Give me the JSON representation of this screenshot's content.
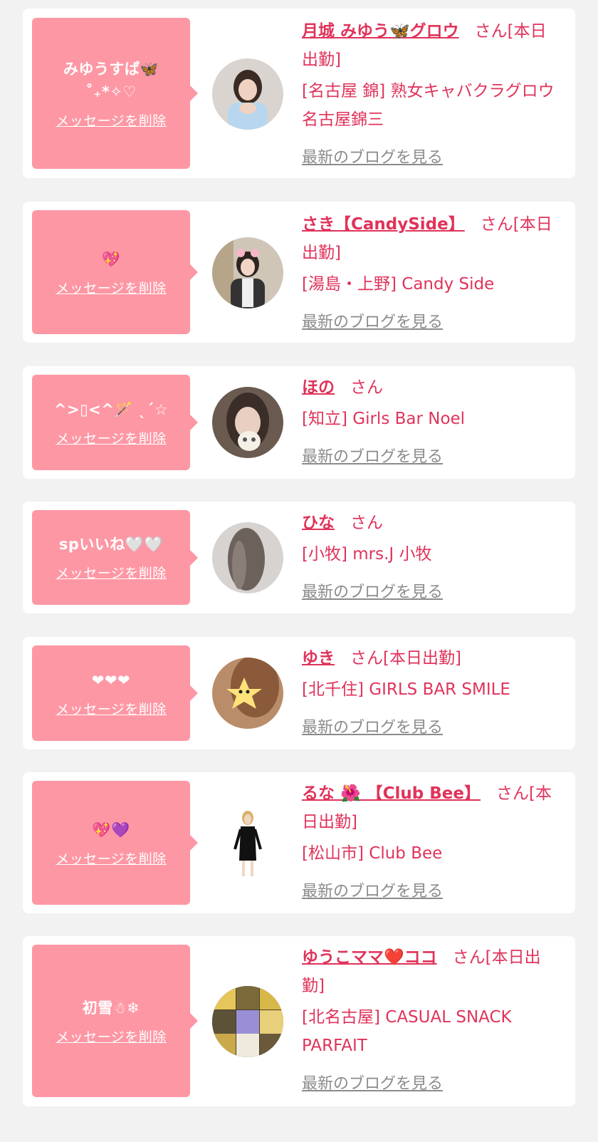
{
  "delete_label": "メッセージを削除",
  "blog_label": "最新のブログを見る",
  "colors": {
    "background": "#f2f2f2",
    "card": "#ffffff",
    "bubble": "#fe97a4",
    "accent": "#e0335a",
    "link_gray": "#8b8b8b"
  },
  "cards": [
    {
      "message": "みゆうすぱ🦋\n˚₊*✧♡",
      "name": "月城 みゆう🦋グロウ",
      "suffix": "さん[本日出勤]",
      "shop": "[名古屋 錦] 熟女キャバクラグロウ 名古屋錦三"
    },
    {
      "message": "💖",
      "name": "さき【CandySide】",
      "suffix": "さん[本日出勤]",
      "shop": "[湯島・上野] Candy Side"
    },
    {
      "message": "^>▯<^🪄 ˎˊ☆",
      "name": "ほの",
      "suffix": "さん",
      "shop": "[知立] Girls Bar Noel"
    },
    {
      "message": "spいいね🤍🤍",
      "name": "ひな",
      "suffix": "さん",
      "shop": "[小牧] mrs.J 小牧"
    },
    {
      "message": "❤❤❤",
      "name": "ゆき",
      "suffix": "さん[本日出勤]",
      "shop": "[北千住] GIRLS BAR SMILE"
    },
    {
      "message": "💖💜",
      "name": "るな 🌺 【Club Bee】",
      "suffix": "さん[本日出勤]",
      "shop": "[松山市] Club Bee"
    },
    {
      "message": "初雪☃❄",
      "name": "ゆうこママ❤️ココ",
      "suffix": "さん[本日出勤]",
      "shop": "[北名古屋] CASUAL SNACK PARFAIT"
    }
  ]
}
